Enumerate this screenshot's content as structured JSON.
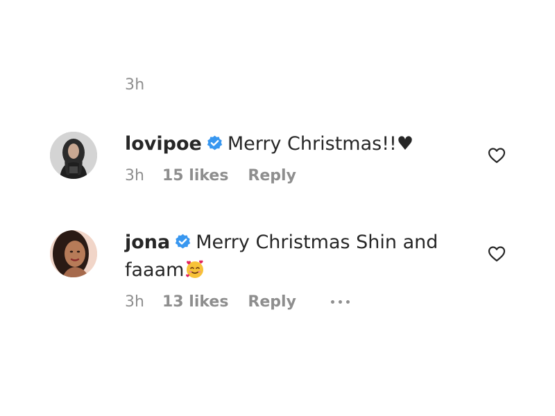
{
  "top_timestamp": "3h",
  "comments": [
    {
      "username": "lovipoe",
      "verified": true,
      "text_line_1": "Merry Christmas!!♥",
      "time": "3h",
      "likes": "15 likes",
      "reply_label": "Reply"
    },
    {
      "username": "jona",
      "verified": true,
      "text_line_1": "Merry Christmas Shin and",
      "text_line_2": "faaam",
      "emoji": "smiling-face-with-hearts",
      "time": "3h",
      "likes": "13 likes",
      "reply_label": "Reply",
      "more_icon": "ellipsis-icon"
    }
  ],
  "colors": {
    "text": "#262626",
    "secondary": "#8e8e8e",
    "verified_blue": "#3897f0"
  }
}
